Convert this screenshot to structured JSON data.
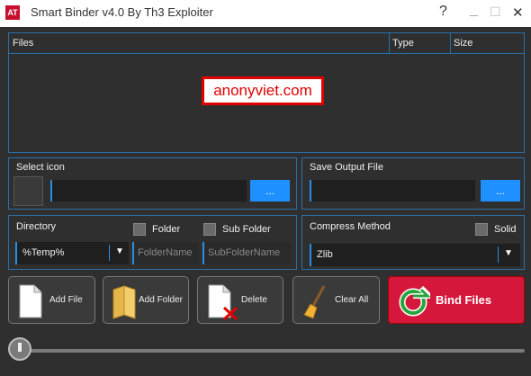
{
  "window": {
    "title": "Smart Binder v4.0 By Th3 Exploiter",
    "app_icon_text": "AT",
    "help": "?",
    "minimize": "_",
    "maximize": "☐",
    "close": "✕"
  },
  "files_table": {
    "col_files": "Files",
    "col_type": "Type",
    "col_size": "Size",
    "watermark": "anonyviet.com"
  },
  "select_icon": {
    "label": "Select icon",
    "path": "",
    "browse": "..."
  },
  "save_output": {
    "label": "Save Output File",
    "path": "",
    "browse": "..."
  },
  "directory": {
    "label": "Directory",
    "folder_label": "Folder",
    "subfolder_label": "Sub Folder",
    "selected": "%Temp%",
    "folder_placeholder": "FolderName",
    "subfolder_placeholder": "SubFolderName"
  },
  "compress": {
    "label": "Compress Method",
    "solid_label": "Solid",
    "selected": "Zlib"
  },
  "actions": {
    "add_file": "Add File",
    "add_folder": "Add Folder",
    "delete": "Delete",
    "clear_all": "Clear All",
    "bind": "Bind Files"
  },
  "colors": {
    "accent": "#2a6fa8",
    "browse": "#1e90ff",
    "bind": "#d6173c",
    "background": "#2f2f2f"
  }
}
